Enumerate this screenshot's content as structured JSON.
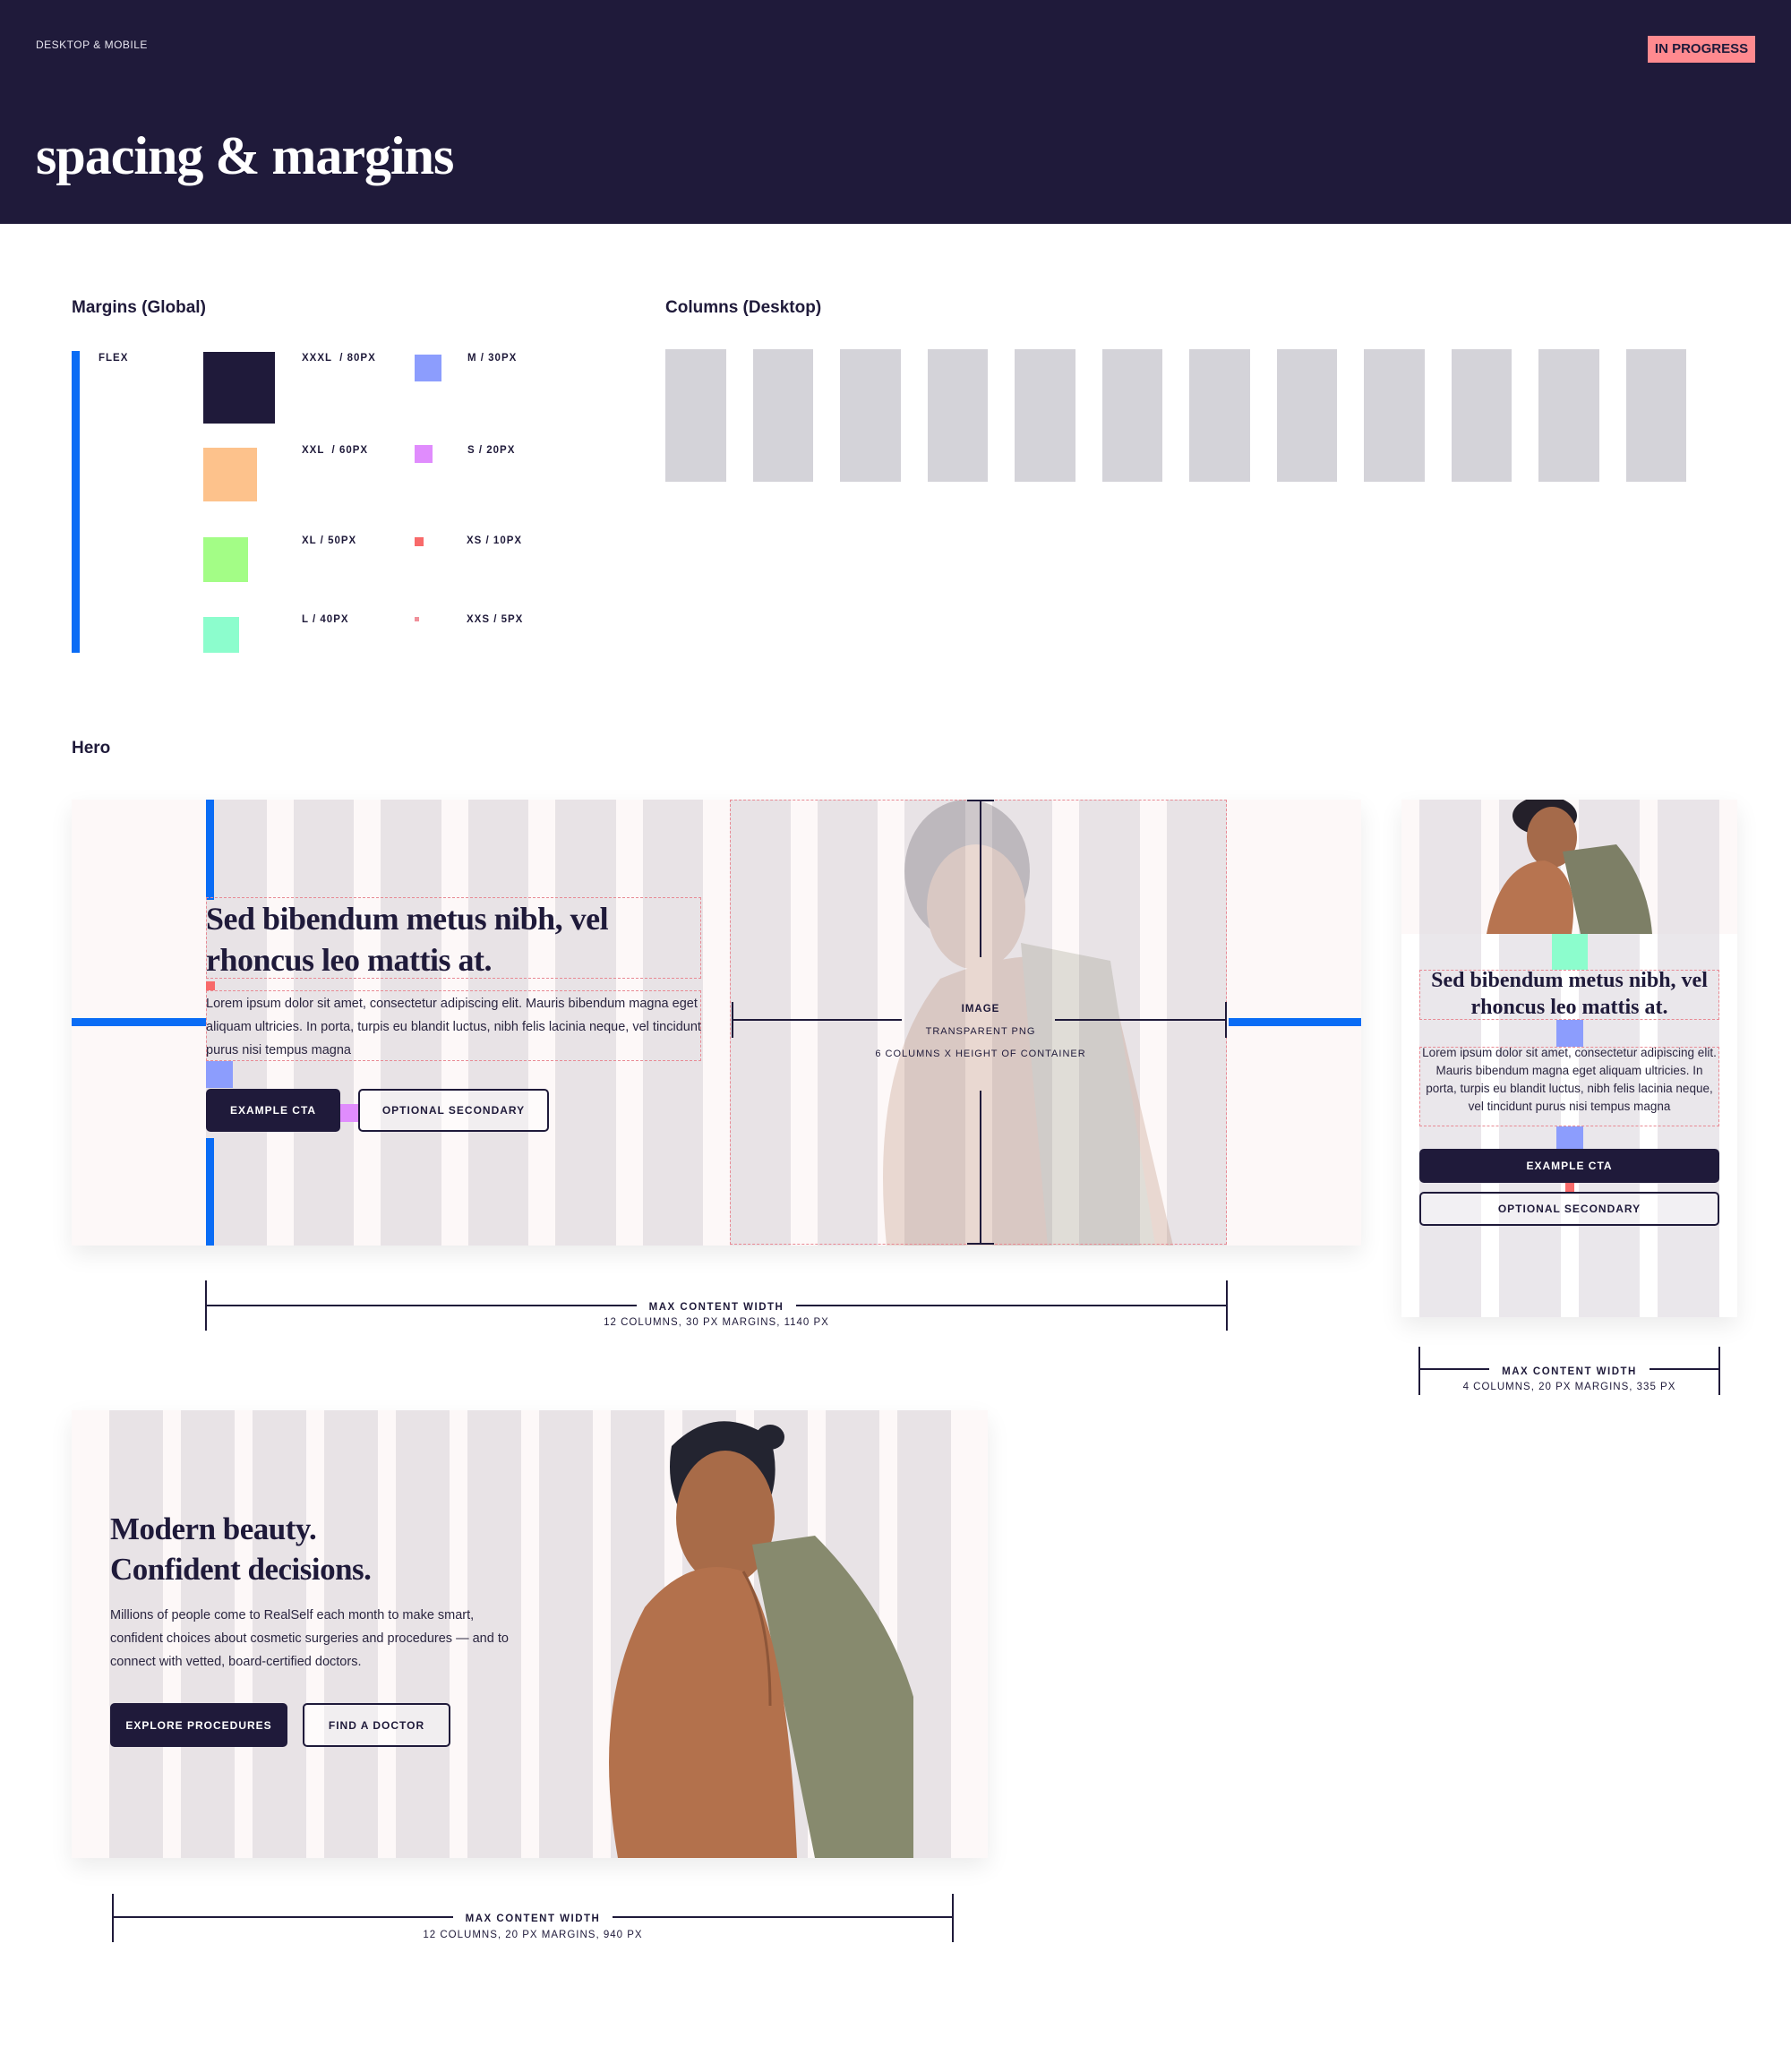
{
  "header": {
    "eyebrow": "DESKTOP & MOBILE",
    "status_badge": "IN PROGRESS",
    "title": "spacing & margins"
  },
  "colors": {
    "navy": "#1f1a3a",
    "badge": "#ff8a8f",
    "flex": "#0a6cf5",
    "column": "#d4d3d9",
    "guide": "#e88a94"
  },
  "margins": {
    "title": "Margins (Global)",
    "flex_label": "FLEX",
    "sizes": [
      {
        "label": "XXXL  / 80PX",
        "color": "#1f1a3a"
      },
      {
        "label": "XXL  / 60PX",
        "color": "#fdc28c"
      },
      {
        "label": "XL / 50PX",
        "color": "#a3fd86"
      },
      {
        "label": "L / 40PX",
        "color": "#8cfdcd"
      },
      {
        "label": "M / 30PX",
        "color": "#8c9dfd"
      },
      {
        "label": "S / 20PX",
        "color": "#e08cfd"
      },
      {
        "label": "XS / 10PX",
        "color": "#f86a6a"
      },
      {
        "label": "XXS / 5PX",
        "color": "#f0909a"
      }
    ]
  },
  "columns_desktop": {
    "title": "Columns (Desktop)",
    "count": 12
  },
  "hero": {
    "title": "Hero",
    "desktop": {
      "headline": "Sed bibendum metus nibh, vel rhoncus leo mattis at.",
      "body": "Lorem ipsum dolor sit amet, consectetur adipiscing elit. Mauris bibendum magna eget aliquam ultricies. In porta, turpis eu blandit luctus, nibh felis lacinia neque, vel tincidunt purus nisi tempus magna",
      "cta": "EXAMPLE CTA",
      "secondary": "OPTIONAL SECONDARY",
      "image_label": "IMAGE",
      "image_type": "TRANSPARENT PNG",
      "image_size": "6 COLUMNS X HEIGHT OF CONTAINER",
      "measure_title": "MAX CONTENT WIDTH",
      "measure_sub": "12 COLUMNS, 30 PX MARGINS, 1140 PX",
      "columns": 12
    },
    "mobile": {
      "headline": "Sed bibendum metus nibh, vel rhoncus leo mattis at.",
      "body": "Lorem ipsum dolor sit amet, consectetur adipiscing elit. Mauris bibendum magna eget aliquam ultricies. In porta, turpis eu blandit luctus, nibh felis lacinia neque, vel tincidunt purus nisi tempus magna",
      "cta": "EXAMPLE CTA",
      "secondary": "OPTIONAL SECONDARY",
      "measure_title": "MAX CONTENT WIDTH",
      "measure_sub": "4 COLUMNS, 20 PX MARGINS, 335 PX",
      "columns": 4
    },
    "example": {
      "headline_1": "Modern beauty.",
      "headline_2": "Confident decisions.",
      "body": "Millions of people come to RealSelf each month to make smart, confident choices about cosmetic surgeries and procedures — and to connect with vetted, board-certified doctors.",
      "cta": "EXPLORE PROCEDURES",
      "secondary": "FIND A DOCTOR",
      "measure_title": "MAX CONTENT WIDTH",
      "measure_sub": "12 COLUMNS, 20 PX MARGINS, 940 PX",
      "columns": 12
    }
  }
}
